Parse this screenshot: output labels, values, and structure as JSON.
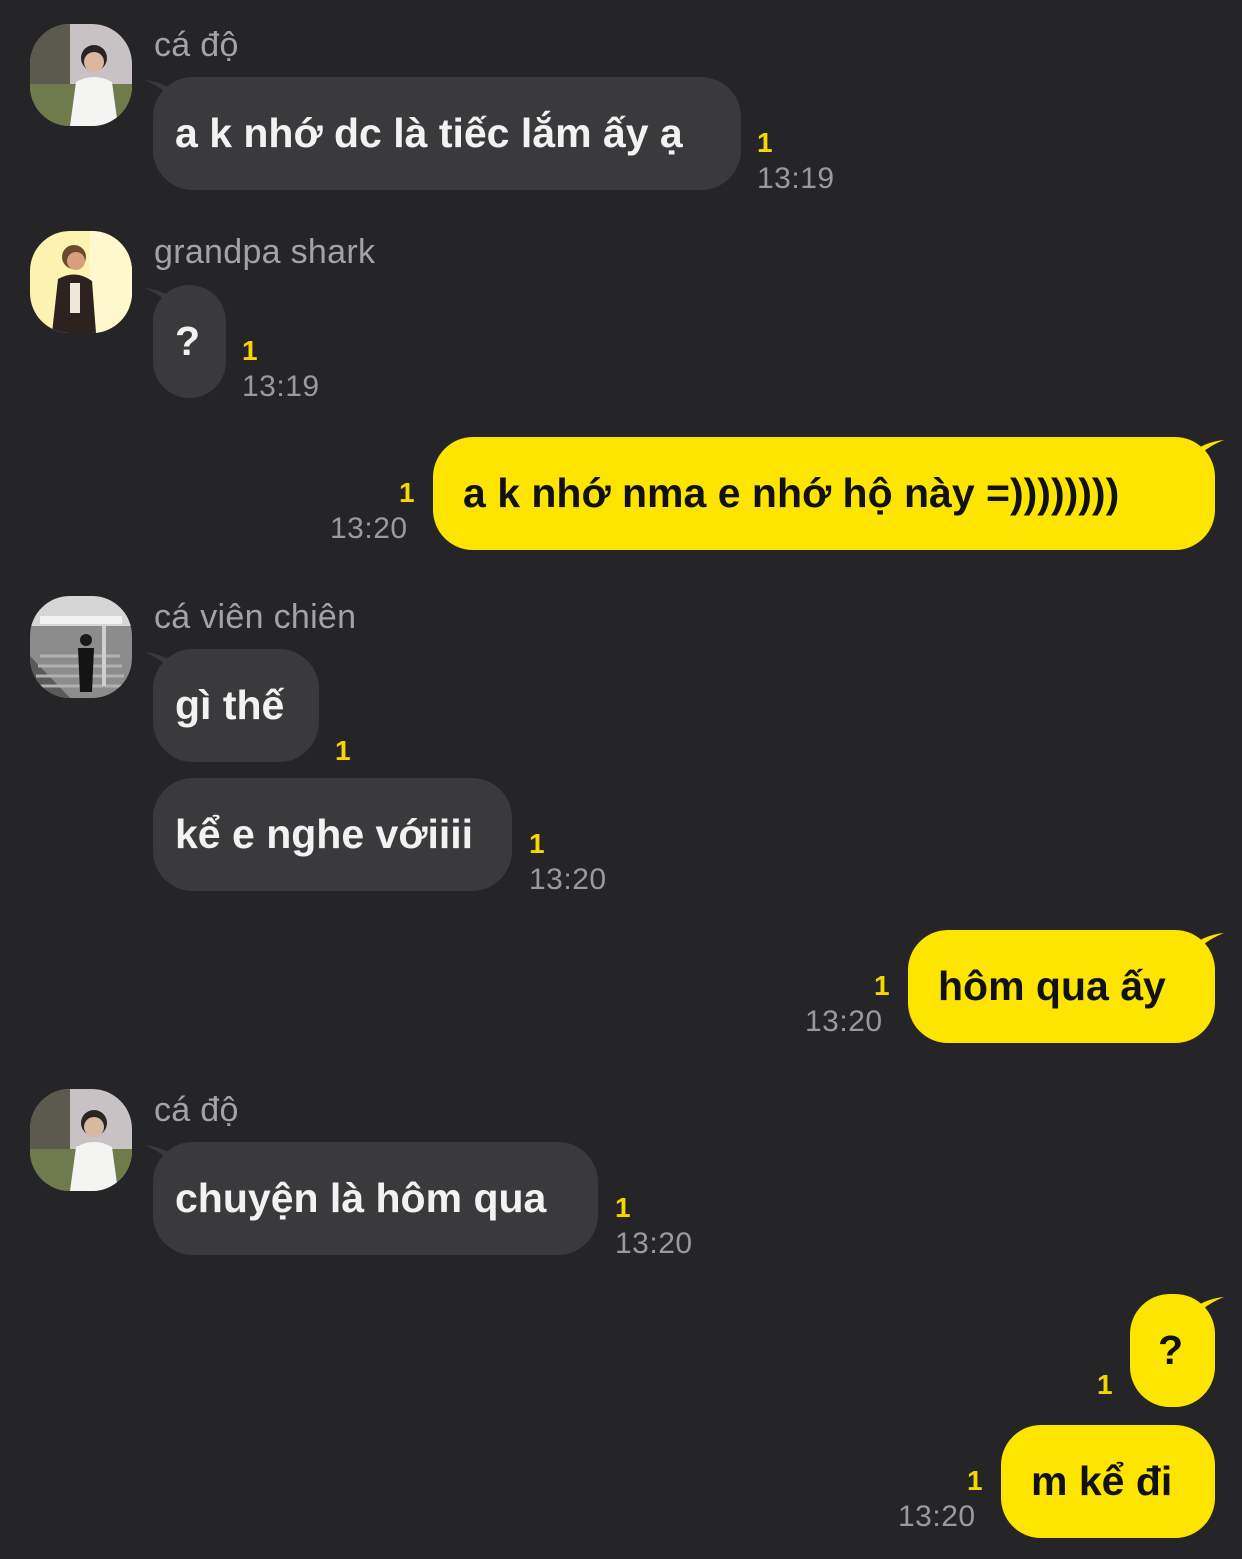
{
  "colors": {
    "background": "#252527",
    "incoming_bubble": "#3a3a3c",
    "outgoing_bubble": "#fee500",
    "unread_indicator": "#f5d800",
    "timestamp": "#9a9a9d",
    "sender_name": "#a3a3a6"
  },
  "messages": [
    {
      "sender": "cá độ",
      "avatar": "avatar-photo-icon",
      "text": "a k nhớ dc là tiếc lắm ấy ạ",
      "unread": "1",
      "time": "13:19"
    },
    {
      "sender": "grandpa shark",
      "avatar": "avatar-photo-icon",
      "text": "?",
      "unread": "1",
      "time": "13:19"
    },
    {
      "sender": "me",
      "text": "a k nhớ nma e nhớ hộ này =))))))))",
      "unread": "1",
      "time": "13:20"
    },
    {
      "sender": "cá viên chiên",
      "avatar": "avatar-photo-icon",
      "text": "gì thế",
      "unread": "1",
      "time": ""
    },
    {
      "sender": "cá viên chiên",
      "text": "kể e nghe vớiiii",
      "unread": "1",
      "time": "13:20"
    },
    {
      "sender": "me",
      "text": "hôm qua ấy",
      "unread": "1",
      "time": "13:20"
    },
    {
      "sender": "cá độ",
      "avatar": "avatar-photo-icon",
      "text": "chuyện là hôm qua",
      "unread": "1",
      "time": "13:20"
    },
    {
      "sender": "me",
      "text": "?",
      "unread": "1",
      "time": ""
    },
    {
      "sender": "me",
      "text": "m kể đi",
      "unread": "1",
      "time": "13:20"
    }
  ]
}
